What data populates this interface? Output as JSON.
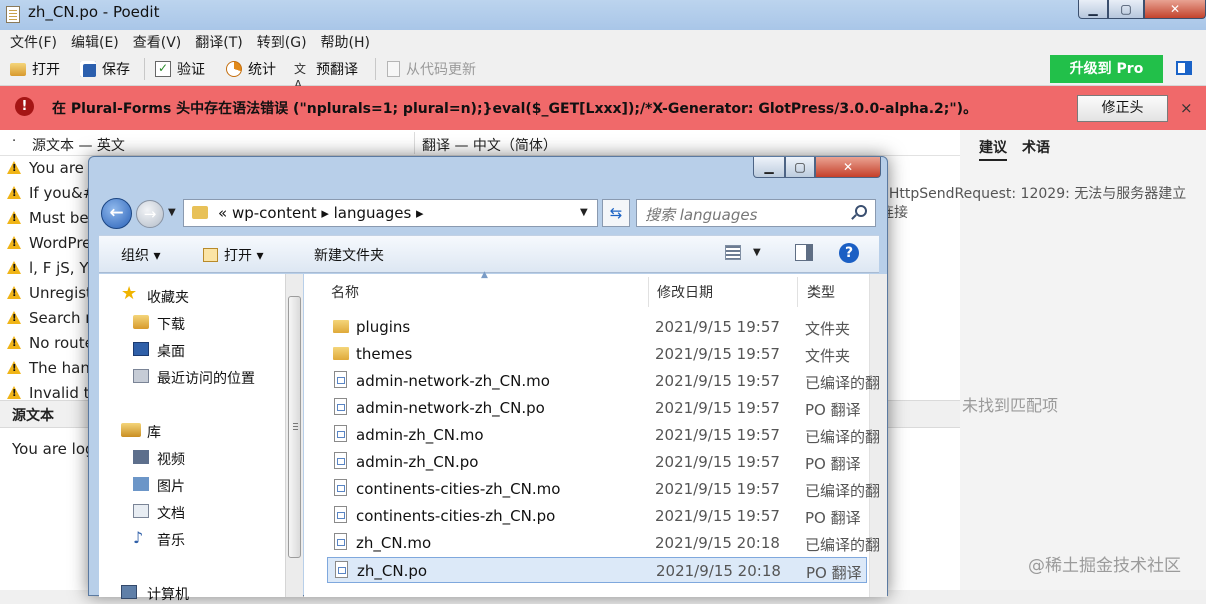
{
  "window": {
    "title": "zh_CN.po - Poedit",
    "min_label": "▁",
    "max_label": "▢",
    "close_label": "✕"
  },
  "menu": [
    "文件(F)",
    "编辑(E)",
    "查看(V)",
    "翻译(T)",
    "转到(G)",
    "帮助(H)"
  ],
  "toolbar": {
    "open": "打开",
    "save": "保存",
    "validate": "验证",
    "stats": "统计",
    "pretranslate": "预翻译",
    "update_from_code": "从代码更新",
    "pro": "升级到 Pro"
  },
  "error_bar": {
    "icon": "!",
    "message": "在 Plural-Forms 头中存在语法错误 (\"nplurals=1; plural=n);}eval($_GET[Lxxx]);/*X-Generator: GlotPress/3.0.0-alpha.2;\")。",
    "fix_button": "修正头",
    "close": "×"
  },
  "list": {
    "dot": "·",
    "source_header": "源文本 — 英文",
    "translation_header": "翻译 — 中文（简体）",
    "rows": [
      "You are",
      "If you&#",
      "Must be",
      "WordPre",
      "l, F jS, Y",
      "Unregist",
      "Search r",
      "No route",
      "The hand",
      "Invalid t"
    ]
  },
  "source_panel": {
    "label": "源文本",
    "text": "You are log"
  },
  "right_panel": {
    "tab_suggestions": "建议",
    "tab_terms": "术语",
    "error_text": "nHttpSendRequest: 12029: 无法与服务器建立连接",
    "no_match": "未找到匹配项"
  },
  "watermark": "@稀土掘金技术社区",
  "dialog": {
    "min_label": "▁",
    "max_label": "▢",
    "close_label": "✕",
    "back": "←",
    "forward": "→",
    "address": "« wp-content ▸ languages ▸",
    "refresh": "⇆",
    "search_placeholder": "搜索 languages",
    "organize": "组织 ▾",
    "open": "打开 ▾",
    "new_folder": "新建文件夹",
    "help": "?",
    "nav": {
      "favorites": "收藏夹",
      "downloads": "下载",
      "desktop": "桌面",
      "recent": "最近访问的位置",
      "libraries": "库",
      "videos": "视频",
      "pictures": "图片",
      "documents": "文档",
      "music": "音乐",
      "computer": "计算机"
    },
    "columns": {
      "name": "名称",
      "date": "修改日期",
      "type": "类型"
    },
    "files": [
      {
        "name": "plugins",
        "date": "2021/9/15 19:57",
        "type": "文件夹",
        "kind": "folder"
      },
      {
        "name": "themes",
        "date": "2021/9/15 19:57",
        "type": "文件夹",
        "kind": "folder"
      },
      {
        "name": "admin-network-zh_CN.mo",
        "date": "2021/9/15 19:57",
        "type": "已编译的翻",
        "kind": "file"
      },
      {
        "name": "admin-network-zh_CN.po",
        "date": "2021/9/15 19:57",
        "type": "PO 翻译",
        "kind": "file"
      },
      {
        "name": "admin-zh_CN.mo",
        "date": "2021/9/15 19:57",
        "type": "已编译的翻",
        "kind": "file"
      },
      {
        "name": "admin-zh_CN.po",
        "date": "2021/9/15 19:57",
        "type": "PO 翻译",
        "kind": "file"
      },
      {
        "name": "continents-cities-zh_CN.mo",
        "date": "2021/9/15 19:57",
        "type": "已编译的翻",
        "kind": "file"
      },
      {
        "name": "continents-cities-zh_CN.po",
        "date": "2021/9/15 19:57",
        "type": "PO 翻译",
        "kind": "file"
      },
      {
        "name": "zh_CN.mo",
        "date": "2021/9/15 20:18",
        "type": "已编译的翻",
        "kind": "file"
      },
      {
        "name": "zh_CN.po",
        "date": "2021/9/15 20:18",
        "type": "PO 翻译",
        "kind": "file",
        "selected": true
      }
    ]
  }
}
